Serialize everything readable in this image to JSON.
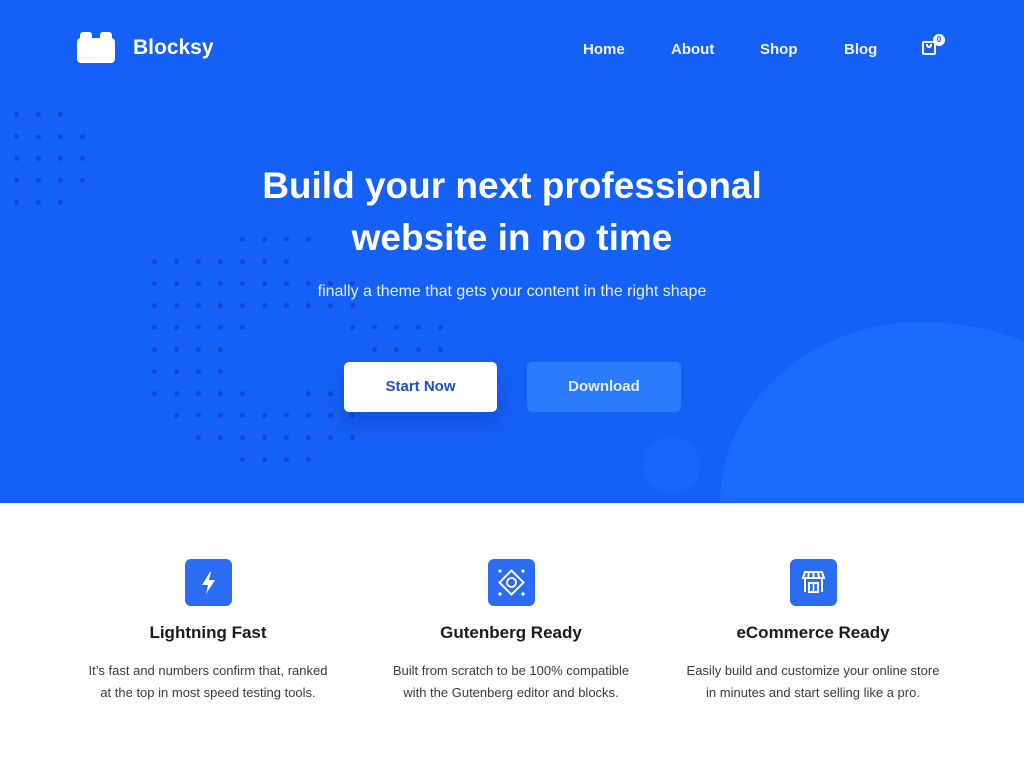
{
  "brand": {
    "name": "Blocksy",
    "color": "#1560f5"
  },
  "nav": {
    "items": [
      {
        "label": "Home"
      },
      {
        "label": "About"
      },
      {
        "label": "Shop"
      },
      {
        "label": "Blog"
      }
    ],
    "cart_icon": "shopping-bag-icon",
    "cart_count": "0"
  },
  "hero": {
    "title_line1": "Build your next professional",
    "title_line2": "website in no time",
    "subtitle": "finally a theme that gets your content in the right shape",
    "primary_button": "Start Now",
    "secondary_button": "Download"
  },
  "features": [
    {
      "icon": "lightning-icon",
      "title": "Lightning Fast",
      "line1": "It’s fast and numbers confirm that, ranked",
      "line2": "at the top in most speed testing tools."
    },
    {
      "icon": "gutenberg-icon",
      "title": "Gutenberg Ready",
      "line1": "Built from scratch to be 100% compatible",
      "line2": "with the Gutenberg editor and blocks."
    },
    {
      "icon": "storefront-icon",
      "title": "eCommerce Ready",
      "line1": "Easily build and customize your online store",
      "line2": "in minutes and start selling like a pro."
    }
  ]
}
